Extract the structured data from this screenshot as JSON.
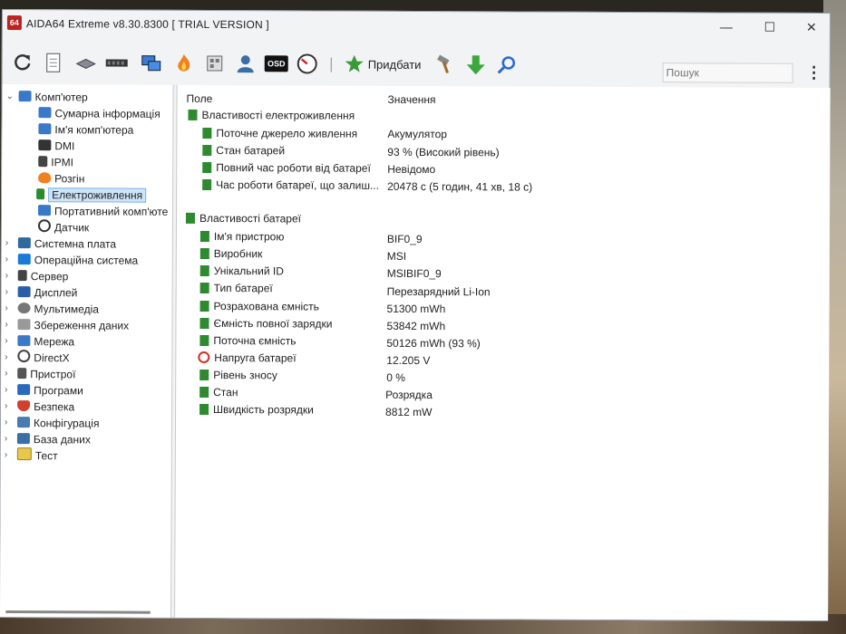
{
  "window": {
    "app_icon_text": "64",
    "title": "AIDA64 Extreme v8.30.8300  [ TRIAL VERSION ]",
    "minimize": "—",
    "maximize": "☐",
    "close": "✕"
  },
  "toolbar": {
    "add_label": "Придбати",
    "search_placeholder": "Пошук",
    "more": "⋮",
    "osd_label": "OSD"
  },
  "tree": {
    "root": "Комп'ютер",
    "children": [
      "Сумарна інформація",
      "Ім'я комп'ютера",
      "DMI",
      "IPMI",
      "Розгін",
      "Електроживлення",
      "Портативний комп'юте",
      "Датчик"
    ],
    "groups": [
      "Системна плата",
      "Операційна система",
      "Сервер",
      "Дисплей",
      "Мультимедіа",
      "Збереження даних",
      "Мережа",
      "DirectX",
      "Пристрої",
      "Програми",
      "Безпека",
      "Конфігурація",
      "База даних",
      "Тест"
    ]
  },
  "columns": {
    "field": "Поле",
    "value": "Значення"
  },
  "power_section": {
    "title": "Властивості електроживлення",
    "rows": [
      {
        "field": "Поточне джерело живлення",
        "value": "Акумулятор"
      },
      {
        "field": "Стан батарей",
        "value": "93 % (Високий рівень)"
      },
      {
        "field": "Повний час роботи від батареї",
        "value": "Невідомо"
      },
      {
        "field": "Час роботи батареї, що залиш...",
        "value": "20478 с (5 годин, 41 хв, 18 с)"
      }
    ]
  },
  "battery_section": {
    "title": "Властивості батареї",
    "rows": [
      {
        "field": "Ім'я пристрою",
        "value": "BIF0_9"
      },
      {
        "field": "Виробник",
        "value": "MSI"
      },
      {
        "field": "Унікальний ID",
        "value": "MSIBIF0_9"
      },
      {
        "field": "Тип батареї",
        "value": "Перезарядний Li-Ion"
      },
      {
        "field": "Розрахована ємність",
        "value": "51300 mWh"
      },
      {
        "field": "Ємність повної зарядки",
        "value": "53842 mWh"
      },
      {
        "field": "Поточна ємність",
        "value": "50126 mWh  (93 %)"
      },
      {
        "field": "Напруга батареї",
        "value": "12.205 V"
      },
      {
        "field": "Рівень зносу",
        "value": "0 %"
      },
      {
        "field": "Стан",
        "value": "Розрядка"
      },
      {
        "field": "Швидкість розрядки",
        "value": "8812 mW"
      }
    ]
  }
}
